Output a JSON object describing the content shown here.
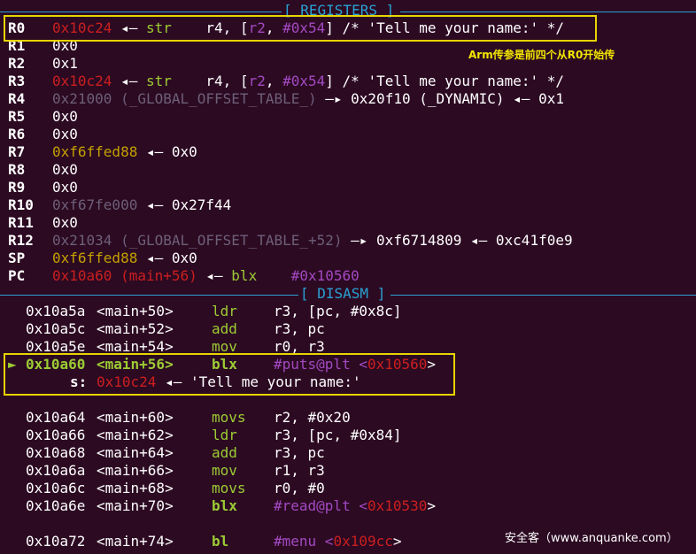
{
  "registers_header": "[ REGISTERS ]",
  "disasm_header": "[ DISASM ]",
  "registers": [
    {
      "name": "R0",
      "value": "0x10c24",
      "rest": " ◂— str    r4, [r2, #0x54] /* 'Tell me your name:' */"
    },
    {
      "name": "R1",
      "value": "0x0",
      "rest": ""
    },
    {
      "name": "R2",
      "value": "0x1",
      "rest": ""
    },
    {
      "name": "R3",
      "value": "0x10c24",
      "rest": " ◂— str    r4, [r2, #0x54] /* 'Tell me your name:' */"
    },
    {
      "name": "R4",
      "value": "0x21000 (_GLOBAL_OFFSET_TABLE_)",
      "rest": " —▸ 0x20f10 (_DYNAMIC) ◂— 0x1"
    },
    {
      "name": "R5",
      "value": "0x0",
      "rest": ""
    },
    {
      "name": "R6",
      "value": "0x0",
      "rest": ""
    },
    {
      "name": "R7",
      "value": "0xf6ffed88",
      "rest": " ◂— 0x0"
    },
    {
      "name": "R8",
      "value": "0x0",
      "rest": ""
    },
    {
      "name": "R9",
      "value": "0x0",
      "rest": ""
    },
    {
      "name": "R10",
      "value": "0xf67fe000",
      "rest": " ◂— 0x27f44"
    },
    {
      "name": "R11",
      "value": "0x0",
      "rest": ""
    },
    {
      "name": "R12",
      "value": "0x21034 (_GLOBAL_OFFSET_TABLE_+52)",
      "rest": " —▸ 0xf6714809 ◂— 0xc41f0e9"
    },
    {
      "name": "SP",
      "value": "0xf6ffed88",
      "rest": " ◂— 0x0"
    },
    {
      "name": "PC",
      "value": "0x10a60 (main+56)",
      "rest": " ◂— blx    #0x10560"
    }
  ],
  "disasm": [
    {
      "addr": "0x10a5a",
      "sym": "<main+50>",
      "mn": "ldr",
      "ops": "r3, [pc, #0x8c]"
    },
    {
      "addr": "0x10a5c",
      "sym": "<main+52>",
      "mn": "add",
      "ops": "r3, pc"
    },
    {
      "addr": "0x10a5e",
      "sym": "<main+54>",
      "mn": "mov",
      "ops": "r0, r3"
    },
    {
      "marker": "►",
      "addr": "0x10a60",
      "sym": "<main+56>",
      "mn": "blx",
      "ops": "#puts@plt <",
      "target": "0x10560",
      "close": ">"
    },
    {
      "arg_name": "s:",
      "arg_value": "0x10c24",
      "arg_rest": " ◂— 'Tell me your name:'"
    },
    {
      "addr": "0x10a64",
      "sym": "<main+60>",
      "mn": "movs",
      "ops": "r2, #0x20"
    },
    {
      "addr": "0x10a66",
      "sym": "<main+62>",
      "mn": "ldr",
      "ops": "r3, [pc, #0x84]"
    },
    {
      "addr": "0x10a68",
      "sym": "<main+64>",
      "mn": "add",
      "ops": "r3, pc"
    },
    {
      "addr": "0x10a6a",
      "sym": "<main+66>",
      "mn": "mov",
      "ops": "r1, r3"
    },
    {
      "addr": "0x10a6c",
      "sym": "<main+68>",
      "mn": "movs",
      "ops": "r0, #0"
    },
    {
      "addr": "0x10a6e",
      "sym": "<main+70>",
      "mn": "blx",
      "ops": "#read@plt <",
      "target": "0x10530",
      "close": ">"
    },
    {
      "addr": "0x10a72",
      "sym": "<main+74>",
      "mn": "bl",
      "ops": "#menu <",
      "target": "0x109cc",
      "close": ">"
    }
  ],
  "annotation": "Arm传参是前四个从R0开始传",
  "watermark": "安全客（www.anquanke.com）"
}
